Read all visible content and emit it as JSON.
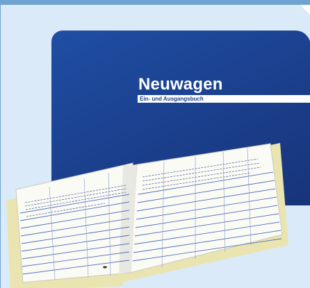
{
  "product": {
    "cover_title": "Neuwagen",
    "cover_subtitle": "Ein- und Ausgangsbuch"
  },
  "colors": {
    "background": "#dbeaf8",
    "frame": "#6fa3d2",
    "cover_blue": "#1b3f8c",
    "page_lines": "#4f6fb8"
  },
  "images": [
    "open-ledger-book"
  ]
}
